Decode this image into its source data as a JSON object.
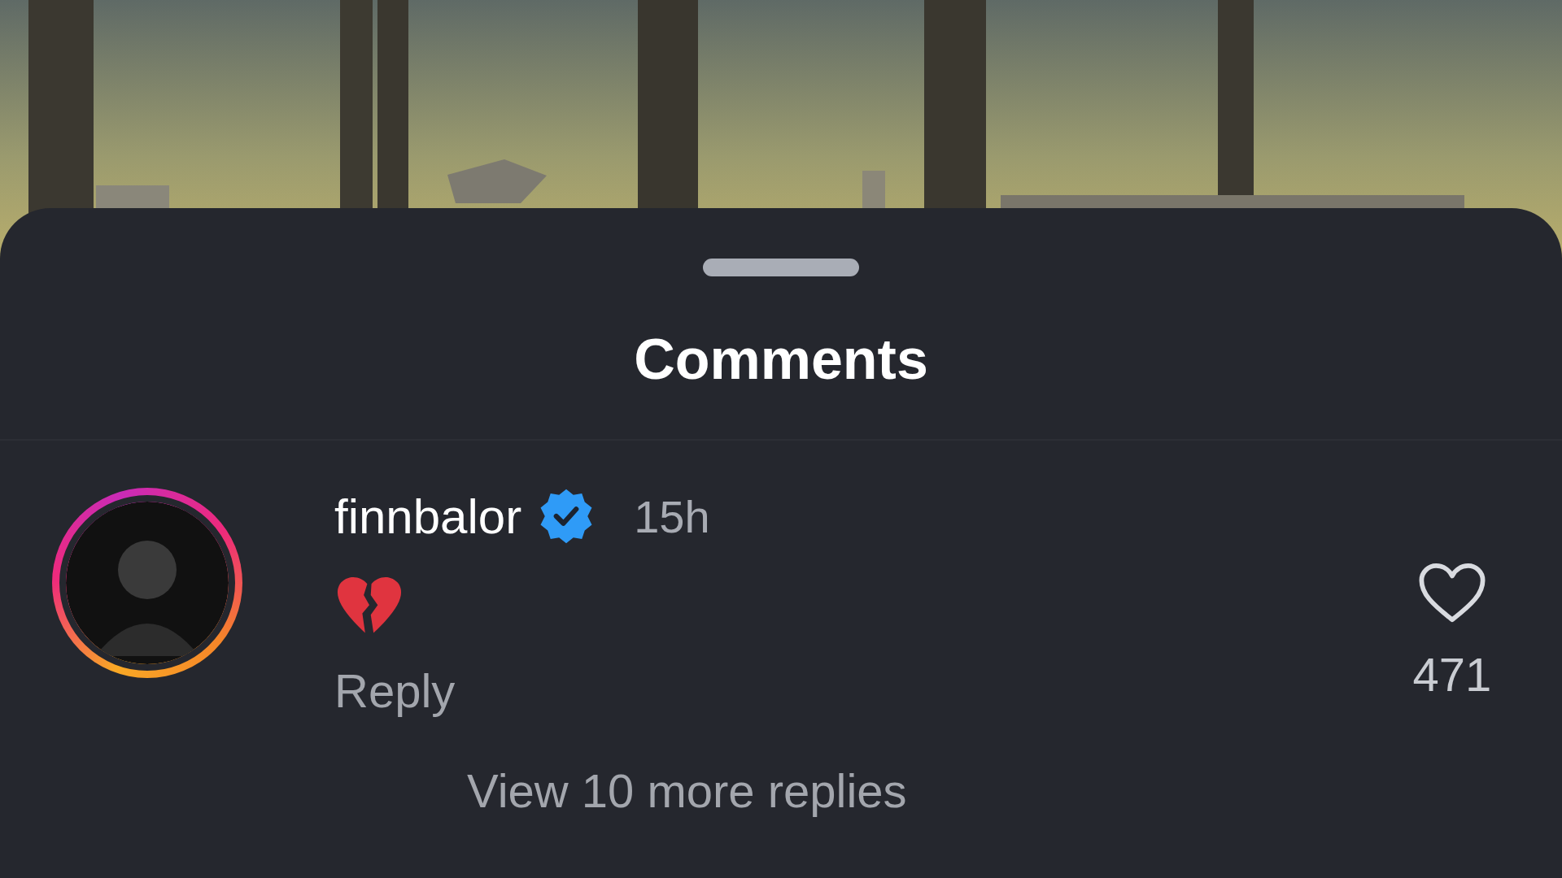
{
  "sheet": {
    "title": "Comments"
  },
  "comments": [
    {
      "username": "finnbalor",
      "verified": true,
      "has_story": true,
      "time": "15h",
      "reply_label": "Reply",
      "likes": "471",
      "liked": false,
      "view_replies": "View 10 more replies"
    }
  ]
}
